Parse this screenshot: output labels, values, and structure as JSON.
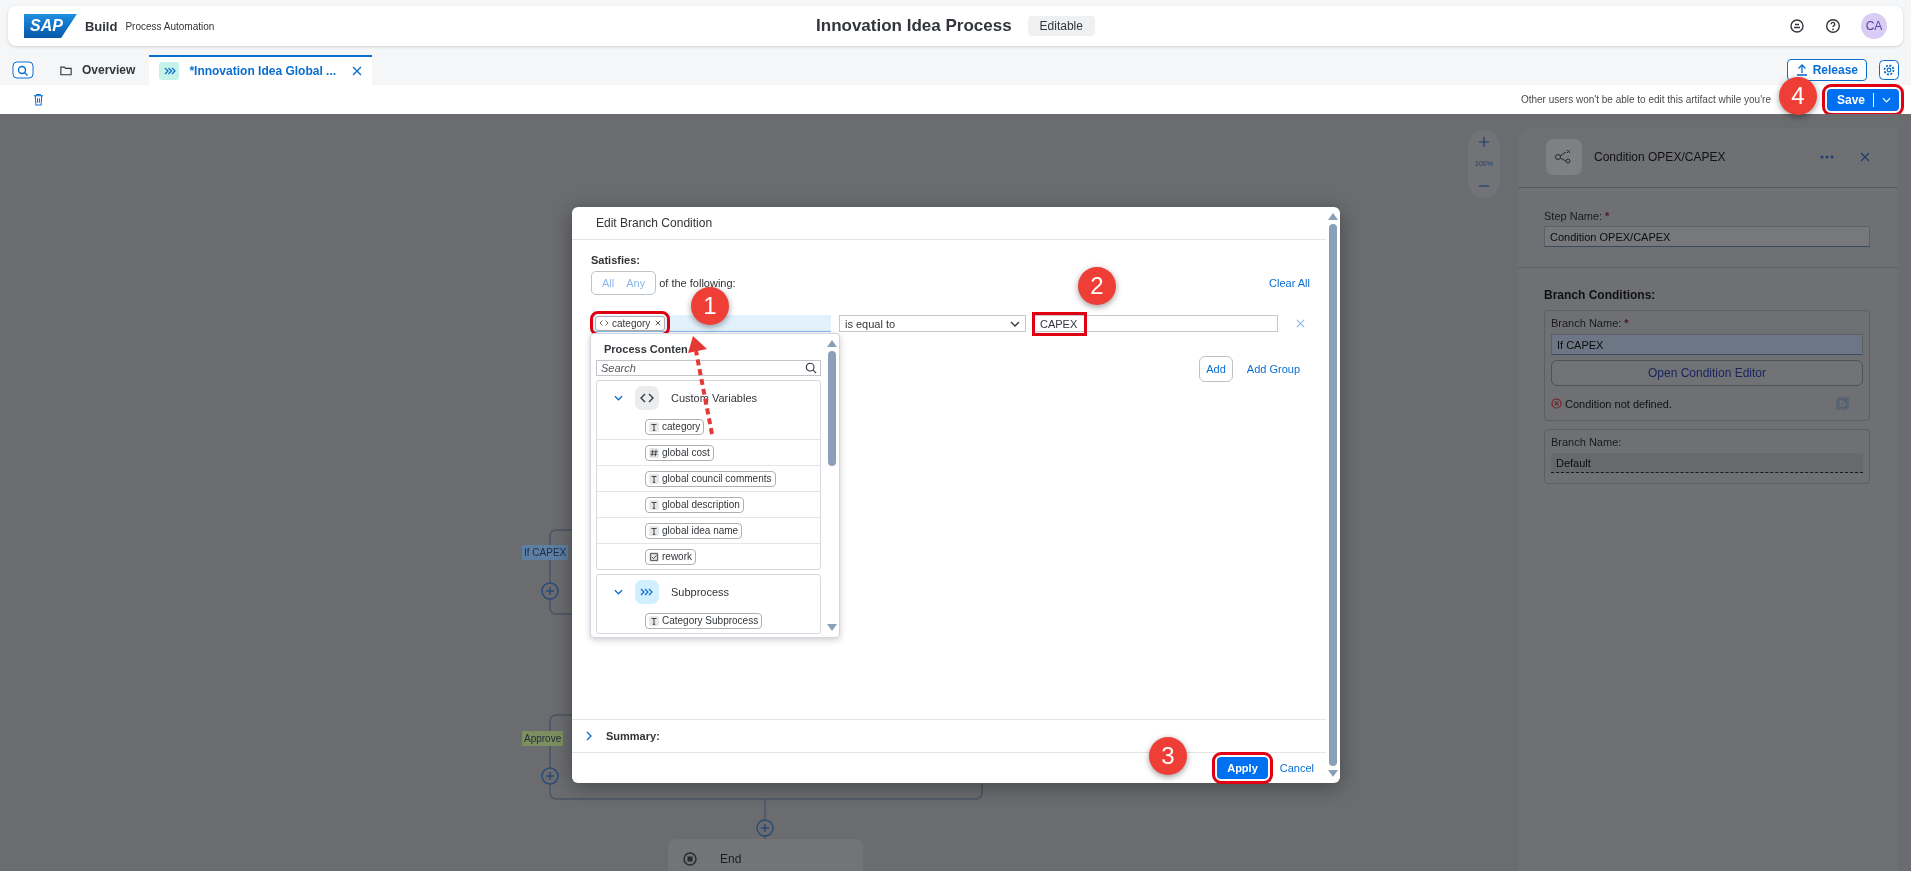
{
  "shell": {
    "logo": "SAP",
    "product": "Build",
    "subtitle": "Process Automation",
    "title": "Innovation Idea Process",
    "status": "Editable",
    "avatar": "CA"
  },
  "tabs": [
    {
      "label": "Overview",
      "selected": false,
      "kind": "folder"
    },
    {
      "label": "*Innovation Idea Global ...",
      "selected": true,
      "kind": "process"
    }
  ],
  "tab_actions": {
    "release": "Release"
  },
  "toolbar": {
    "notice": "Other users won't be able to edit this artifact while you're",
    "save": {
      "label": "Save",
      "callout": "4"
    }
  },
  "canvas": {
    "zoom": "100%",
    "branches": [
      {
        "label": "If CAPEX",
        "color": "#5d7fa3"
      },
      {
        "label": "Approve",
        "color": "#7d8f5e"
      }
    ],
    "end": "End"
  },
  "dialog": {
    "title": "Edit Branch Condition",
    "satisfies": "Satisfies:",
    "options": [
      {
        "label": "All",
        "selected": false
      },
      {
        "label": "Any",
        "selected": false
      }
    ],
    "of_following": "of the following:",
    "clear_all": "Clear All",
    "condition": {
      "token": "category",
      "token_callout": "1",
      "operator": "is equal to",
      "value": "CAPEX",
      "value_callout": "2"
    },
    "add": "Add",
    "add_group": "Add Group",
    "summary": {
      "label": "Summary:",
      "expanded": false
    },
    "apply": {
      "label": "Apply",
      "callout": "3"
    },
    "cancel": "Cancel",
    "picker": {
      "heading": "Process Conten",
      "search": {
        "placeholder": "Search"
      },
      "groups": [
        {
          "label": "Custom Variables",
          "kind": "variables",
          "expanded": true,
          "items": [
            {
              "label": "category",
              "kind": "text"
            },
            {
              "label": "global cost",
              "kind": "number"
            },
            {
              "label": "global council comments",
              "kind": "text"
            },
            {
              "label": "global description",
              "kind": "text"
            },
            {
              "label": "global idea name",
              "kind": "text"
            },
            {
              "label": "rework",
              "kind": "boolean"
            }
          ]
        },
        {
          "label": "Subprocess",
          "kind": "subprocess",
          "expanded": true,
          "items": [
            {
              "label": "Category Subprocess",
              "kind": "text"
            }
          ]
        }
      ]
    }
  },
  "panel": {
    "title": "Condition OPEX/CAPEX",
    "step_name": {
      "label": "Step Name:",
      "required_mark": "*",
      "value": "Condition OPEX/CAPEX"
    },
    "branch_heading": "Branch Conditions:",
    "branches": [
      {
        "label": "Branch Name:",
        "required_mark": "*",
        "value": "If CAPEX",
        "button": "Open Condition Editor",
        "error": "Condition not defined."
      },
      {
        "label": "Branch Name:",
        "value": "Default"
      }
    ]
  }
}
